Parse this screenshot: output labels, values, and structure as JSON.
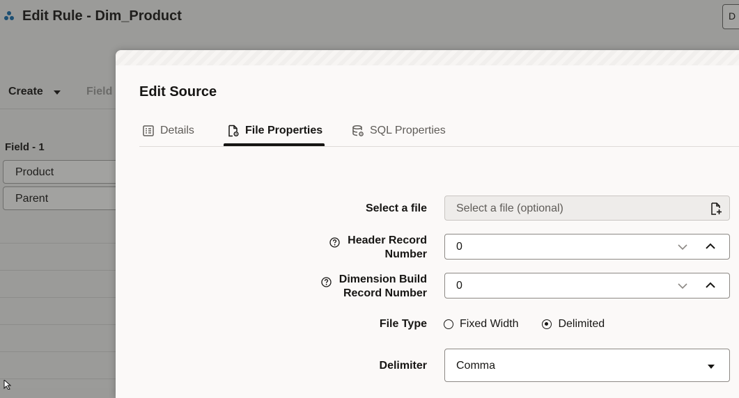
{
  "background": {
    "title": "Edit Rule - Dim_Product",
    "top_button": "D",
    "toolbar": {
      "create_label": "Create",
      "field_label": "Field"
    },
    "grid": {
      "header": "Field - 1",
      "cells": [
        "Product",
        "Parent"
      ]
    }
  },
  "dialog": {
    "title": "Edit Source",
    "tabs": [
      {
        "label": "Details"
      },
      {
        "label": "File Properties"
      },
      {
        "label": "SQL Properties"
      }
    ],
    "active_tab": "File Properties",
    "fields": {
      "select_file": {
        "label": "Select a file",
        "placeholder": "Select a file (optional)"
      },
      "header_record": {
        "label_line1": "Header Record",
        "label_line2": "Number",
        "value": "0"
      },
      "dim_build_record": {
        "label_line1": "Dimension Build",
        "label_line2": "Record Number",
        "value": "0"
      },
      "file_type": {
        "label": "File Type",
        "options": [
          "Fixed Width",
          "Delimited"
        ],
        "selected": "Delimited"
      },
      "delimiter": {
        "label": "Delimiter",
        "value": "Comma"
      }
    }
  },
  "colors": {
    "text_primary": "#161513",
    "text_secondary": "#5f5c58",
    "dialog_bg": "#fbf9f8",
    "overlay_bg": "#9b9b99",
    "accent": "#161513"
  }
}
